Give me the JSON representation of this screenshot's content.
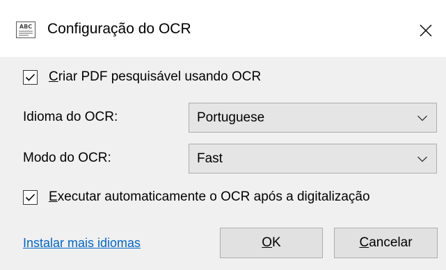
{
  "dialog": {
    "title": "Configuração do OCR",
    "icon": "abc-scan-icon",
    "close_icon": "close-icon"
  },
  "options": {
    "searchable_pdf": {
      "mnemonic": "C",
      "rest": "riar PDF pesquisável usando OCR",
      "checked": true
    },
    "auto_ocr": {
      "mnemonic": "E",
      "rest": "xecutar automaticamente o OCR após a digitalização",
      "checked": true
    }
  },
  "language": {
    "label": "Idioma do OCR:",
    "value": "Portuguese"
  },
  "mode": {
    "label": "Modo do OCR:",
    "value": "Fast"
  },
  "footer": {
    "install_link": "Instalar mais idiomas",
    "ok": {
      "mnemonic": "O",
      "rest": "K"
    },
    "cancel": {
      "mnemonic": "C",
      "rest": "ancelar"
    }
  },
  "colors": {
    "link": "#0066cc",
    "button_bg": "#e1e1e1",
    "dialog_bg": "#f0f0f0"
  }
}
